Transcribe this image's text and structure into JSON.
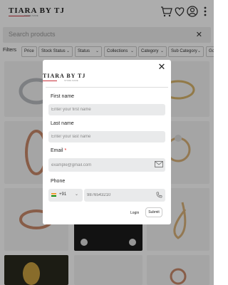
{
  "brand": {
    "name": "TIARA BY TJ",
    "tagline": "STORE NAME",
    "accent": "#c8323c"
  },
  "header": {
    "icons": [
      "cart-icon",
      "heart-icon",
      "user-icon",
      "menu-icon"
    ]
  },
  "search": {
    "placeholder": "Search products"
  },
  "filters": {
    "label": "Filters",
    "chips": [
      "Price",
      "Stock Status",
      "Status",
      "Collections",
      "Category",
      "Sub Category",
      "Go"
    ]
  },
  "modal": {
    "first_name": {
      "label": "First name",
      "placeholder": "Enter your first name"
    },
    "last_name": {
      "label": "Last name",
      "placeholder": "Enter your last name"
    },
    "email": {
      "label": "Email",
      "required_mark": "*",
      "placeholder": "example@gmail.com"
    },
    "phone": {
      "label": "Phone",
      "country_code": "+91",
      "placeholder": "9876543210"
    },
    "login_label": "Login",
    "submit_label": "Submit"
  }
}
